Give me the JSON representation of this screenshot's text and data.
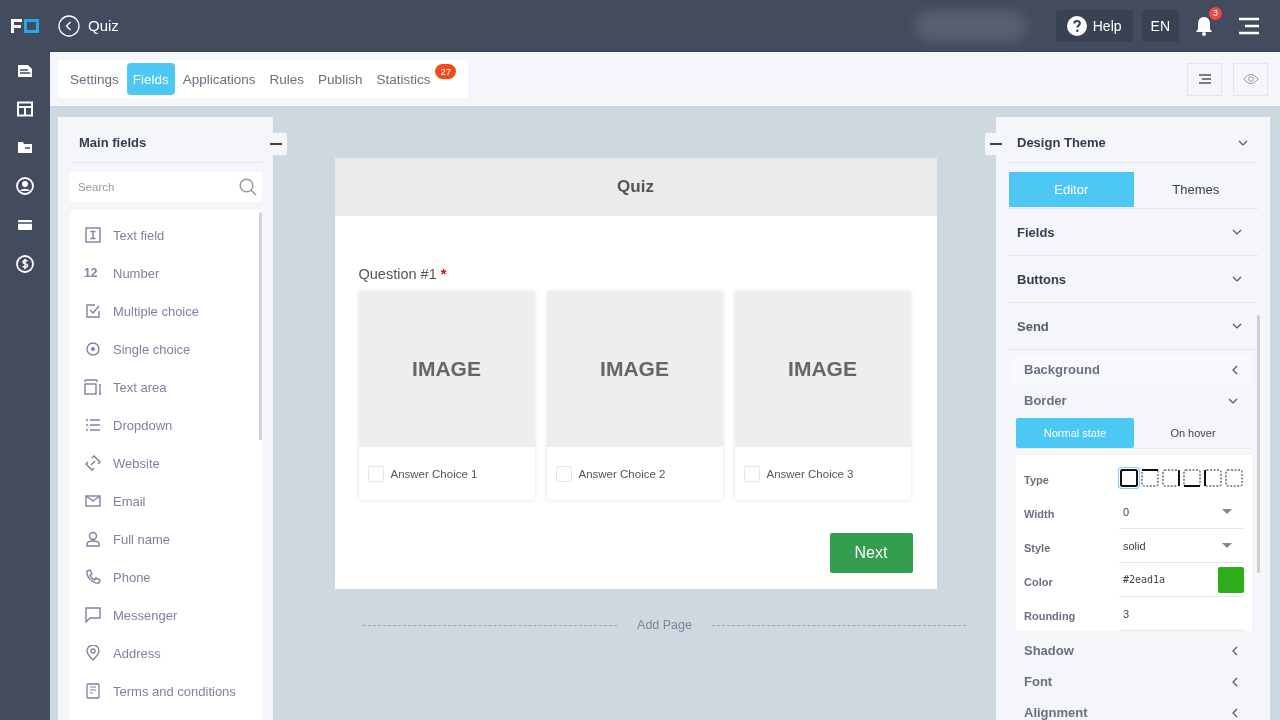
{
  "header": {
    "title": "Quiz",
    "help": "Help",
    "language": "EN",
    "notifications": "3"
  },
  "tabs": [
    {
      "label": "Settings",
      "selected": false
    },
    {
      "label": "Fields",
      "selected": true
    },
    {
      "label": "Applications",
      "selected": false
    },
    {
      "label": "Rules",
      "selected": false
    },
    {
      "label": "Publish",
      "selected": false
    },
    {
      "label": "Statistics",
      "selected": false,
      "badge": "27"
    }
  ],
  "fields_panel": {
    "title": "Main fields",
    "search": {
      "placeholder": "Search"
    },
    "items": [
      {
        "label": "Text field",
        "kind": "text"
      },
      {
        "label": "Number",
        "kind": "number",
        "icon_text": "12"
      },
      {
        "label": "Multiple choice",
        "kind": "checkbox"
      },
      {
        "label": "Single choice",
        "kind": "radio"
      },
      {
        "label": "Text area",
        "kind": "textarea"
      },
      {
        "label": "Dropdown",
        "kind": "list"
      },
      {
        "label": "Website",
        "kind": "link"
      },
      {
        "label": "Email",
        "kind": "mail"
      },
      {
        "label": "Full name",
        "kind": "person"
      },
      {
        "label": "Phone",
        "kind": "phone"
      },
      {
        "label": "Messenger",
        "kind": "chat"
      },
      {
        "label": "Address",
        "kind": "pin"
      },
      {
        "label": "Terms and conditions",
        "kind": "document"
      }
    ]
  },
  "form": {
    "title": "Quiz",
    "question": "Question #1",
    "required_mark": "*",
    "choices": [
      {
        "image_text": "IMAGE",
        "label": "Answer Choice 1",
        "checked": false
      },
      {
        "image_text": "IMAGE",
        "label": "Answer Choice 2",
        "checked": false
      },
      {
        "image_text": "IMAGE",
        "label": "Answer Choice 3",
        "checked": false
      }
    ],
    "button": "Next",
    "add_page": "Add Page"
  },
  "design_panel": {
    "title": "Design Theme",
    "tabs": [
      {
        "label": "Editor",
        "selected": true
      },
      {
        "label": "Themes",
        "selected": false
      }
    ],
    "sections": [
      {
        "label": "Fields",
        "expanded": false
      },
      {
        "label": "Buttons",
        "expanded": false
      },
      {
        "label": "Send",
        "expanded": true
      }
    ],
    "subsections": [
      {
        "label": "Background",
        "expanded": false
      },
      {
        "label": "Border",
        "expanded": true
      },
      {
        "label": "Shadow",
        "expanded": false
      },
      {
        "label": "Font",
        "expanded": false
      },
      {
        "label": "Alignment",
        "expanded": false
      }
    ],
    "state_tabs": [
      {
        "label": "Normal state",
        "selected": true
      },
      {
        "label": "On hover",
        "selected": false
      }
    ],
    "type_label": "Type",
    "border_types": [
      {
        "kind": "all",
        "selected": true
      },
      {
        "kind": "top",
        "selected": false
      },
      {
        "kind": "right",
        "selected": false
      },
      {
        "kind": "bottom",
        "selected": false
      },
      {
        "kind": "left",
        "selected": false
      },
      {
        "kind": "none",
        "selected": false
      }
    ],
    "properties": [
      {
        "label": "Width",
        "kind": "select",
        "value": "0"
      },
      {
        "label": "Style",
        "kind": "select",
        "value": "solid"
      },
      {
        "label": "Color",
        "kind": "color",
        "value": "#2ead1a",
        "color": "#2ead1a"
      },
      {
        "label": "Rounding",
        "kind": "text",
        "value": "3"
      }
    ]
  }
}
